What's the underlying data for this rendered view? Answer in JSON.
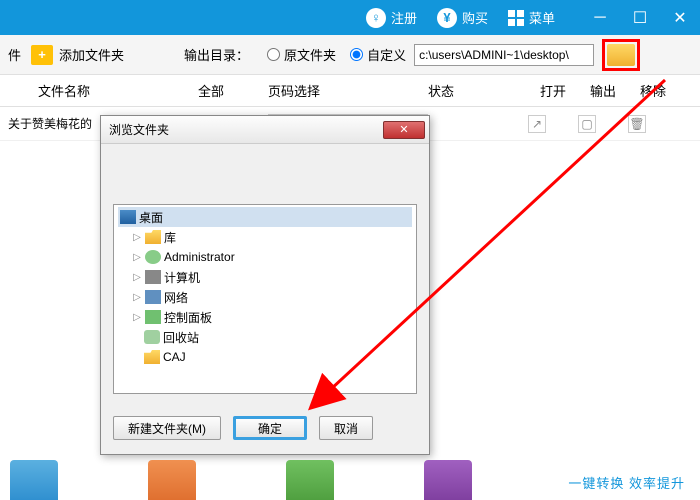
{
  "titlebar": {
    "register": "注册",
    "buy": "购买",
    "menu": "菜单"
  },
  "toolbar": {
    "add_folder_prefix": "件",
    "add_folder": "添加文件夹",
    "output_label": "输出目录：",
    "radio_original": "原文件夹",
    "radio_custom": "自定义",
    "path_value": "c:\\users\\ADMINI~1\\desktop\\"
  },
  "columns": {
    "name": "文件名称",
    "all": "全部",
    "page": "页码选择",
    "status": "状态",
    "open": "打开",
    "output": "输出",
    "remove": "移除"
  },
  "row": {
    "filename": "关于赞美梅花的"
  },
  "dialog": {
    "title": "浏览文件夹",
    "tree": {
      "desktop": "桌面",
      "library": "库",
      "admin": "Administrator",
      "computer": "计算机",
      "network": "网络",
      "control": "控制面板",
      "recycle": "回收站",
      "caj": "CAJ"
    },
    "new_folder": "新建文件夹(M)",
    "ok": "确定",
    "cancel": "取消"
  },
  "slogan": "一键转换  效率提升"
}
